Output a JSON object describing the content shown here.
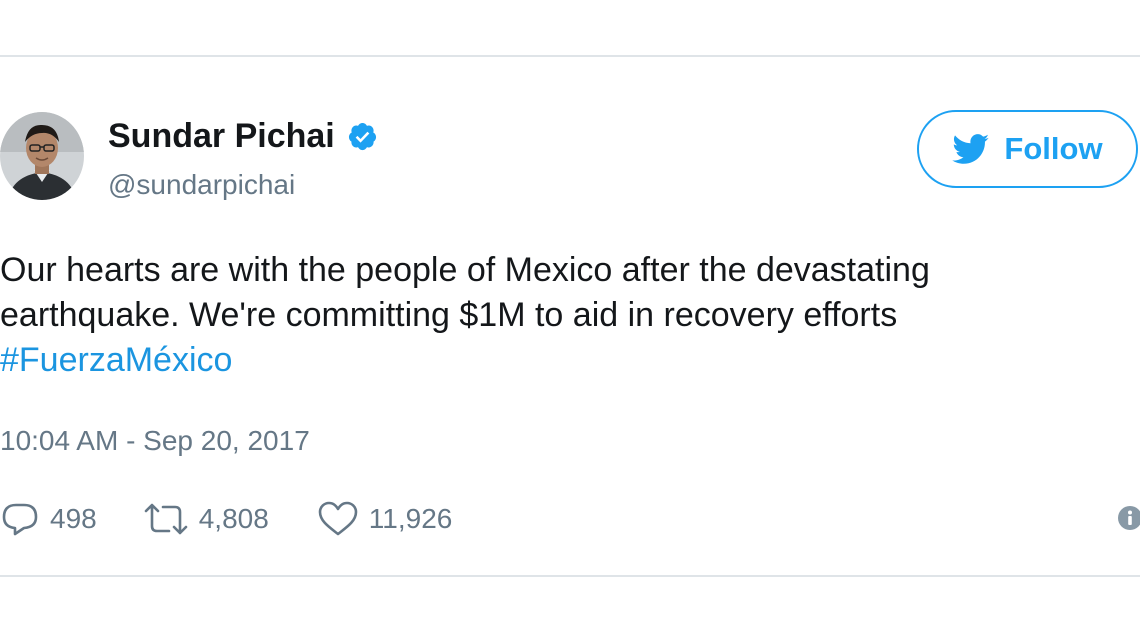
{
  "author": {
    "name": "Sundar Pichai",
    "handle": "@sundarpichai",
    "verified": true
  },
  "follow_button": {
    "label": "Follow",
    "icon": "twitter-bird-icon"
  },
  "tweet": {
    "lines": [
      "Our hearts are with the people of Mexico after the devastating",
      "earthquake. We're committing $1M to aid in recovery efforts"
    ],
    "hashtag": "#FuerzaMéxico",
    "timestamp": "10:04 AM - Sep 20, 2017"
  },
  "stats": {
    "replies": "498",
    "retweets": "4,808",
    "likes": "11,926"
  },
  "colors": {
    "accent": "#1da1f2",
    "link": "#1b95e0",
    "text": "#14171a",
    "muted": "#657786"
  }
}
